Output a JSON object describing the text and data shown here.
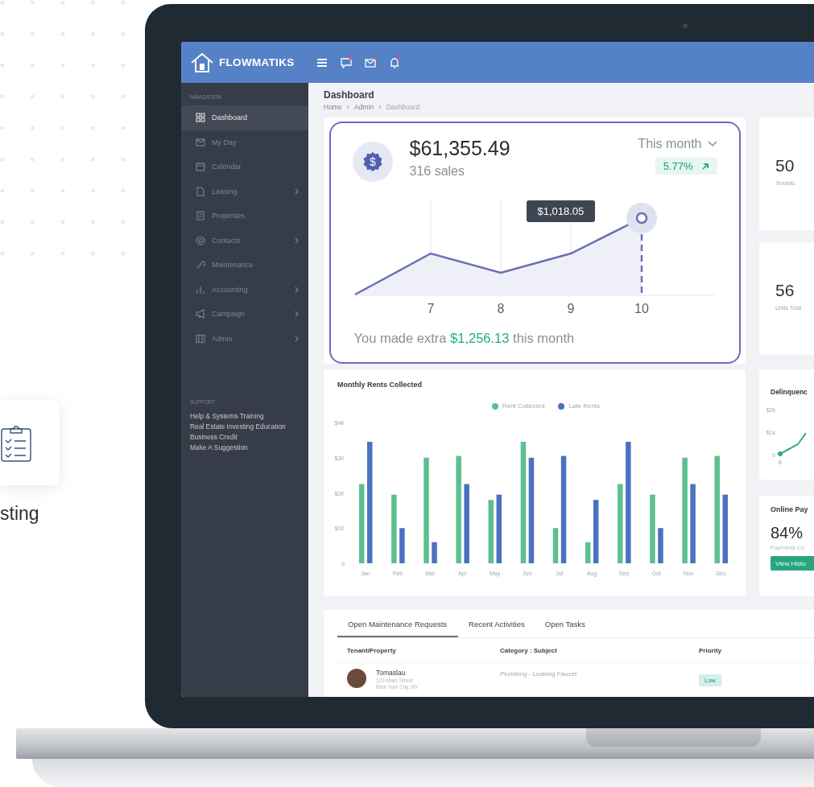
{
  "promo": {
    "card_label": "sting"
  },
  "header": {
    "brand": "FLOWMATIKS",
    "icons": [
      {
        "kind": "menu",
        "badge": false
      },
      {
        "kind": "chat",
        "badge": true
      },
      {
        "kind": "mail",
        "badge": true
      },
      {
        "kind": "bell",
        "badge": true
      }
    ]
  },
  "sidebar": {
    "section": "NAVIGATION",
    "items": [
      {
        "label": "Dashboard",
        "kind": "grid",
        "selected": true,
        "submenu": false
      },
      {
        "label": "My Day",
        "kind": "mail",
        "selected": false,
        "submenu": false
      },
      {
        "label": "Calendar",
        "kind": "calendar",
        "selected": false,
        "submenu": false
      },
      {
        "label": "Leasing",
        "kind": "document",
        "selected": false,
        "submenu": true
      },
      {
        "label": "Properties",
        "kind": "building",
        "selected": false,
        "submenu": false
      },
      {
        "label": "Contacts",
        "kind": "at",
        "selected": false,
        "submenu": true
      },
      {
        "label": "Maintenance",
        "kind": "wrench",
        "selected": false,
        "submenu": false
      },
      {
        "label": "Accounting",
        "kind": "bars",
        "selected": false,
        "submenu": true
      },
      {
        "label": "Campaign",
        "kind": "megaphone",
        "selected": false,
        "submenu": true
      },
      {
        "label": "Admin",
        "kind": "map",
        "selected": false,
        "submenu": true
      }
    ],
    "support_title": "SUPPORT",
    "support_links": [
      "Help & Systems Training",
      "Real Estate Investing Education",
      "Business Credit",
      "Make A Suggestion"
    ]
  },
  "page": {
    "title": "Dashboard",
    "separator": "›",
    "breadcrumb": [
      {
        "label": "Home",
        "current": false
      },
      {
        "label": "Admin",
        "current": false
      },
      {
        "label": "Dashboard",
        "current": true
      }
    ]
  },
  "sales_card": {
    "icon_glyph": "$",
    "amount": "$61,355.49",
    "sales": "316 sales",
    "period": "This month",
    "change": "5.77%",
    "tooltip": "$1,018.05",
    "x_labels": [
      "7",
      "8",
      "9",
      "10"
    ],
    "footer": {
      "prefix": "You made extra",
      "amount": "$1,256.13",
      "suffix": "this month"
    }
  },
  "stats": [
    {
      "value": "50",
      "label": "Tenants"
    },
    {
      "value": "56",
      "label": "Units Total"
    }
  ],
  "rents": {
    "title": "Monthly Rents Collected",
    "chart_data": {
      "type": "bar",
      "categories": [
        "Jan",
        "Feb",
        "Mar",
        "Apr",
        "May",
        "Jun",
        "Jul",
        "Aug",
        "Sep",
        "Oct",
        "Nov",
        "Dec"
      ],
      "series": [
        {
          "name": "Rent Collected",
          "color": "#5dbf8e",
          "values": [
            2250,
            1950,
            3000,
            3050,
            1800,
            3450,
            1000,
            600,
            2250,
            1950,
            3000,
            3050
          ]
        },
        {
          "name": "Late Rents",
          "color": "#4a72c0",
          "values": [
            3450,
            1000,
            600,
            2250,
            1950,
            3000,
            3050,
            1800,
            3450,
            1000,
            2250,
            1950
          ]
        }
      ],
      "ylim": [
        0,
        4000
      ],
      "yticks": [
        {
          "value": 0,
          "label": "0"
        },
        {
          "value": 1000,
          "label": "$1K"
        },
        {
          "value": 2000,
          "label": "$2K"
        },
        {
          "value": 3000,
          "label": "$3K"
        },
        {
          "value": 4000,
          "label": "$4K"
        }
      ]
    }
  },
  "delinquency": {
    "title": "Delinquenc",
    "y_labels": [
      "$2k",
      "$1k",
      "0"
    ],
    "x_label": "8"
  },
  "online_payments": {
    "title": "Online Pay",
    "value": "84%",
    "label": "Payments Co",
    "button": "View Histo"
  },
  "requests": {
    "tabs": [
      {
        "label": "Open Maintenance Requests",
        "selected": true
      },
      {
        "label": "Recent Activities",
        "selected": false
      },
      {
        "label": "Open Tasks",
        "selected": false
      }
    ],
    "columns": [
      "Tenant/Property",
      "Category : Subject",
      "Priority"
    ],
    "rows": [
      {
        "name": "Tomaslau",
        "address": "123 Main Street",
        "city": "New York City, NY",
        "subject": "Plumbing - Leaking Faucet",
        "priority": "Low"
      }
    ]
  }
}
